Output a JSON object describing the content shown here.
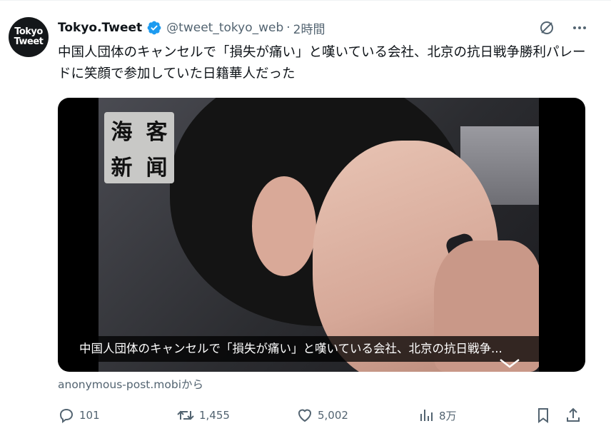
{
  "account": {
    "avatar_line1": "Tokyo",
    "avatar_line2": "Tweet",
    "name": "Tokyo.Tweet",
    "handle": "@tweet_tokyo_web",
    "separator": "·",
    "time": "2時間"
  },
  "tweet": {
    "text": "中国人団体のキャンセルで「損失が痛い」と嘆いている会社、北京の抗日戦争勝利パレードに笑顔で参加していた日籍華人だった"
  },
  "media": {
    "watermark": [
      "海",
      "客",
      "新",
      "闻"
    ],
    "caption": "中国人団体のキャンセルで「損失が痛い」と嘆いている会社、北京の抗日戦争..."
  },
  "source": {
    "label": "anonymous-post.mobiから"
  },
  "actions": {
    "replies": "101",
    "reposts": "1,455",
    "likes": "5,002",
    "views": "8万"
  },
  "colors": {
    "text": "#0f1419",
    "secondary": "#536471",
    "verified": "#1d9bf0"
  },
  "icons": {
    "verified": "verified-badge-icon",
    "grok": "grok-icon",
    "more": "more-icon",
    "reply": "reply-icon",
    "repost": "repost-icon",
    "like": "like-icon",
    "views": "views-icon",
    "bookmark": "bookmark-icon",
    "share": "share-icon",
    "expand": "chevron-down-icon"
  }
}
